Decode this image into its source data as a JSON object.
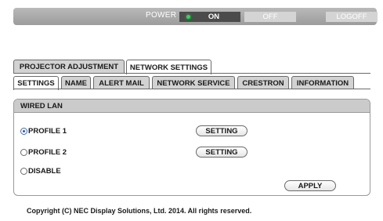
{
  "power_bar": {
    "label": "POWER",
    "on_label": "ON",
    "off_label": "OFF",
    "logoff_label": "LOGOFF"
  },
  "main_tabs": [
    {
      "label": "PROJECTOR ADJUSTMENT",
      "active": false
    },
    {
      "label": "NETWORK SETTINGS",
      "active": true
    }
  ],
  "sub_tabs": [
    {
      "label": "SETTINGS",
      "active": true
    },
    {
      "label": "NAME",
      "active": false
    },
    {
      "label": "ALERT MAIL",
      "active": false
    },
    {
      "label": "NETWORK SERVICE",
      "active": false
    },
    {
      "label": "CRESTRON",
      "active": false
    },
    {
      "label": "INFORMATION",
      "active": false
    }
  ],
  "wired_lan": {
    "header": "WIRED LAN",
    "options": [
      {
        "label": "PROFILE 1",
        "selected": true,
        "button": "SETTING"
      },
      {
        "label": "PROFILE 2",
        "selected": false,
        "button": "SETTING"
      },
      {
        "label": "DISABLE",
        "selected": false
      }
    ],
    "apply_label": "APPLY"
  },
  "footer": {
    "copyright": "Copyright (C) NEC Display Solutions, Ltd. 2014. All rights reserved."
  },
  "colors": {
    "power_led": "#20e04a",
    "bar_gray": "#9c9c9c",
    "header_gray": "#cbcbcb",
    "radio_selected": "#2c5aa0"
  }
}
